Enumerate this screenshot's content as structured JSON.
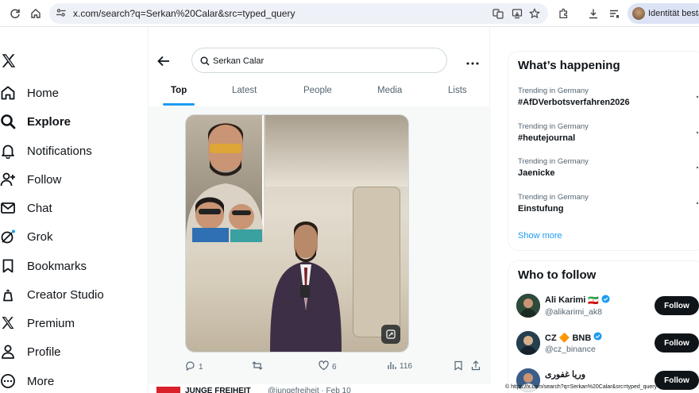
{
  "browser": {
    "url": "x.com/search?q=Serkan%20Calar&src=typed_query",
    "profile_label": "Identität bestä"
  },
  "sidebar": {
    "items": [
      {
        "label": "Home",
        "icon": "home-icon"
      },
      {
        "label": "Explore",
        "icon": "search-icon",
        "active": true
      },
      {
        "label": "Notifications",
        "icon": "bell-icon"
      },
      {
        "label": "Follow",
        "icon": "add-person-icon"
      },
      {
        "label": "Chat",
        "icon": "envelope-icon"
      },
      {
        "label": "Grok",
        "icon": "grok-icon"
      },
      {
        "label": "Bookmarks",
        "icon": "bookmark-icon"
      },
      {
        "label": "Creator Studio",
        "icon": "creator-studio-icon"
      },
      {
        "label": "Premium",
        "icon": "x-premium-icon"
      },
      {
        "label": "Profile",
        "icon": "person-icon"
      },
      {
        "label": "More",
        "icon": "more-circle-icon"
      }
    ]
  },
  "search": {
    "query": "Serkan Calar"
  },
  "tabs": [
    {
      "label": "Top",
      "active": true
    },
    {
      "label": "Latest"
    },
    {
      "label": "People"
    },
    {
      "label": "Media"
    },
    {
      "label": "Lists"
    }
  ],
  "post": {
    "replies": "1",
    "likes": "6",
    "views": "116"
  },
  "next_post": {
    "name": "JUNGE FREIHEIT",
    "handle": "@jungefreiheit · Feb 10"
  },
  "trends": {
    "title": "What’s happening",
    "items": [
      {
        "context": "Trending in Germany",
        "name": "#AfDVerbotsverfahren2026"
      },
      {
        "context": "Trending in Germany",
        "name": "#heutejournal"
      },
      {
        "context": "Trending in Germany",
        "name": "Jaenicke"
      },
      {
        "context": "Trending in Germany",
        "name": "Einstufung"
      }
    ],
    "show_more": "Show more"
  },
  "who_to_follow": {
    "title": "Who to follow",
    "follow_label": "Follow",
    "accounts": [
      {
        "name": "Ali Karimi",
        "flag": "🇮🇷",
        "handle": "@alikarimi_ak8"
      },
      {
        "name": "CZ 🔶 BNB",
        "handle": "@cz_binance"
      },
      {
        "name": "وریا غفوری",
        "handle": ""
      }
    ]
  },
  "watermark": "© https://x.com/search?q=Serkan%20Calar&src=typed_query",
  "colors": {
    "accent": "#1d9bf0",
    "text": "#0f1419",
    "muted": "#536471",
    "jf_red": "#d8212a"
  }
}
